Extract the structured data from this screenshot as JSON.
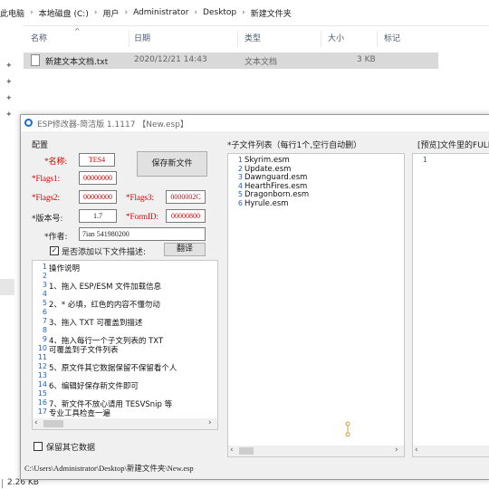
{
  "explorer": {
    "breadcrumb": [
      "此电脑",
      "本地磁盘 (C:)",
      "用户",
      "Administrator",
      "Desktop",
      "新建文件夹"
    ],
    "columns": {
      "name": "名称",
      "date": "日期",
      "type": "类型",
      "size": "大小",
      "tag": "标记"
    },
    "file": {
      "name": "新建文本文档.txt",
      "date": "2020/12/21 14:43",
      "type": "文本文档",
      "size": "3 KB"
    },
    "status_size": "2.26 KB"
  },
  "dialog": {
    "title": "ESP修改器-简洁版 1.1117 【New.esp】",
    "config_label": "配置",
    "fields": {
      "name_label": "*名称:",
      "name_value": "TES4",
      "flags1_label": "*Flags1:",
      "flags1_value": "00000000",
      "flags2_label": "*Flags2:",
      "flags2_value": "00000000",
      "flags3_label": "*Flags3:",
      "flags3_value": "0000002C",
      "version_label": "*版本号:",
      "version_value": "1.7",
      "formid_label": "*FormID:",
      "formid_value": "00000800",
      "author_label": "*作者:",
      "author_value": "7ian 541980200"
    },
    "save_button": "保存新文件",
    "add_desc_label": "是否添加以下文件描述:",
    "translate_button": "翻译",
    "description_lines": [
      {
        "n": "1",
        "t": "操作说明"
      },
      {
        "n": "2",
        "t": ""
      },
      {
        "n": "3",
        "t": "1、拖入 ESP/ESM 文件加载信息"
      },
      {
        "n": "4",
        "t": ""
      },
      {
        "n": "5",
        "t": "2、* 必填，红色的内容不懂勿动"
      },
      {
        "n": "6",
        "t": ""
      },
      {
        "n": "7",
        "t": "3、拖入 TXT 可覆盖到描述"
      },
      {
        "n": "8",
        "t": ""
      },
      {
        "n": "9",
        "t": "4、拖入每行一个子文列表的 TXT"
      },
      {
        "n": "10",
        "t": "    可覆盖到子文件列表"
      },
      {
        "n": "11",
        "t": ""
      },
      {
        "n": "12",
        "t": "5、原文件其它数据保留不保留看个人"
      },
      {
        "n": "13",
        "t": ""
      },
      {
        "n": "14",
        "t": "6、编辑好保存新文件即可"
      },
      {
        "n": "15",
        "t": ""
      },
      {
        "n": "16",
        "t": "7、新文件不放心请用 TESVSnip 等"
      },
      {
        "n": "17",
        "t": "    专业工具检查一遍"
      }
    ],
    "keep_data_label": "保留其它数据",
    "subfile_title": "*子文件列表（每行1个,空行自动删）",
    "subfiles": [
      {
        "n": "1",
        "t": "Skyrim.esm"
      },
      {
        "n": "2",
        "t": "Update.esm"
      },
      {
        "n": "3",
        "t": "Dawnguard.esm"
      },
      {
        "n": "4",
        "t": "HearthFires.esm"
      },
      {
        "n": "5",
        "t": "Dragonborn.esm"
      },
      {
        "n": "6",
        "t": "Hyrule.esm"
      }
    ],
    "preview_title": "[预览]文件里的FULL",
    "preview_lines": [
      {
        "n": "1",
        "t": ""
      }
    ],
    "path": "C:\\Users\\Administrator\\Desktop\\新建文件夹\\New.esp"
  }
}
